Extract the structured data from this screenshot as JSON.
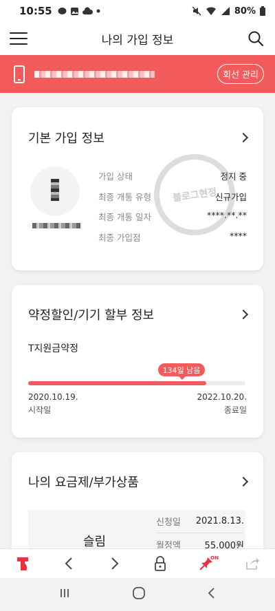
{
  "status": {
    "time": "10:55",
    "battery": "80%",
    "left_icons": [
      "chat-icon",
      "gallery-icon",
      "cloud-icon",
      "dot-icon"
    ],
    "right_icons": [
      "mute-icon",
      "wifi-icon",
      "signal-icon",
      "battery-icon"
    ]
  },
  "header": {
    "title": "나의 가입 정보"
  },
  "banner": {
    "manage_label": "회선 관리",
    "bg_color": "#f25b5b"
  },
  "basic_info": {
    "title": "기본 가입 정보",
    "watermark": "블로그현정",
    "rows": [
      {
        "label": "가입 상태",
        "value": "정지 중"
      },
      {
        "label": "최종 개통 유형",
        "value": "신규가입"
      },
      {
        "label": "최종 개통 일자",
        "value": "****.**.**"
      },
      {
        "label": "최종 가입점",
        "value": "****"
      }
    ]
  },
  "contract": {
    "title": "약정할인/기기 할부 정보",
    "name": "T지원금약정",
    "remaining": "134일 남음",
    "progress_percent": 82,
    "start_date": "2020.10.19.",
    "start_label": "시작일",
    "end_date": "2022.10.20.",
    "end_label": "종료일"
  },
  "plan": {
    "title": "나의 요금제/부가상품",
    "name": "슬림",
    "rows": [
      {
        "label": "신청일",
        "value": "2021.8.13."
      },
      {
        "label": "월정액",
        "value": "55,000원"
      }
    ]
  },
  "bottom_toolbar": {
    "items": [
      "tworld-logo-icon",
      "back-arrow-icon",
      "forward-arrow-icon",
      "lock-icon",
      "pin-icon",
      "share-icon"
    ],
    "pin_state": "ON"
  },
  "accent_color": "#f25b5b"
}
